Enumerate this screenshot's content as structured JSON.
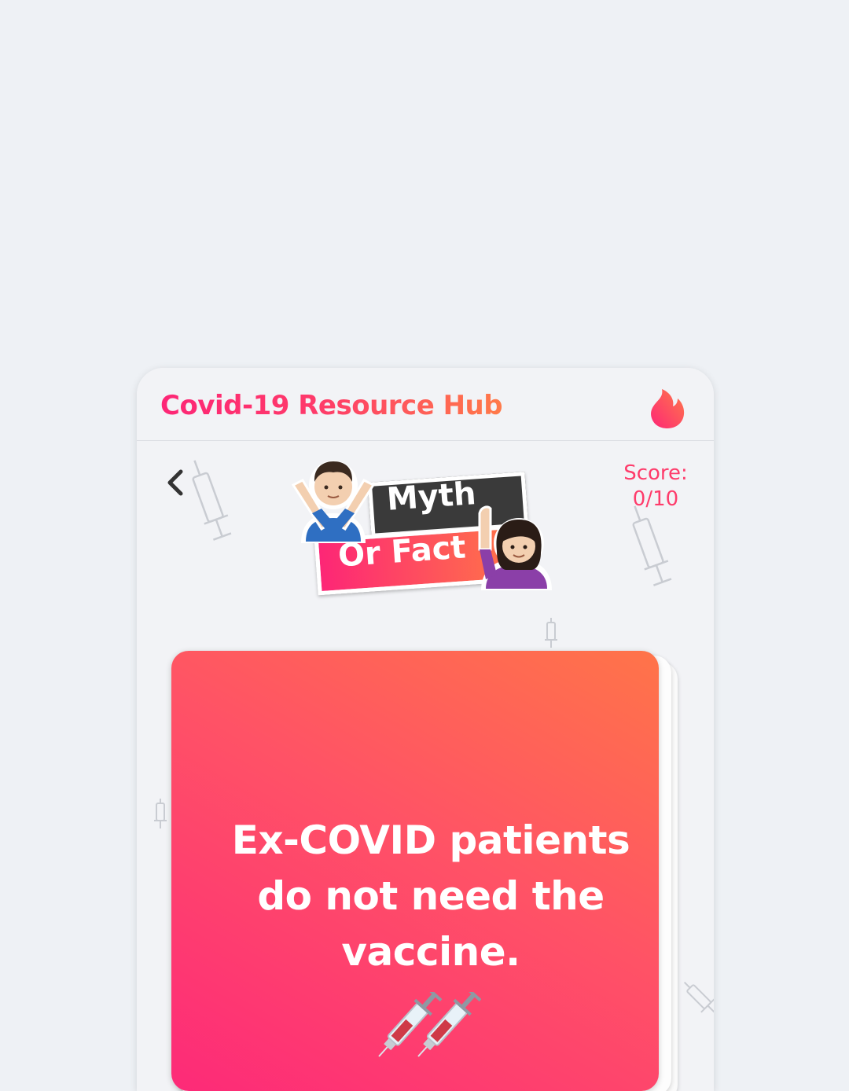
{
  "app": {
    "title": "Covid-19 Resource Hub",
    "logo_icon": "flame-icon",
    "brand_colors": {
      "pink": "#fd2676",
      "orange": "#ff7a49"
    }
  },
  "nav": {
    "back_icon": "chevron-left-icon"
  },
  "quiz_logo": {
    "word1": "Myth",
    "word2": "Or Fact"
  },
  "score": {
    "label": "Score:",
    "value": "0/10"
  },
  "card": {
    "statement": "Ex-COVID patients do not need the vaccine.",
    "emoji": "syringe-icon"
  }
}
